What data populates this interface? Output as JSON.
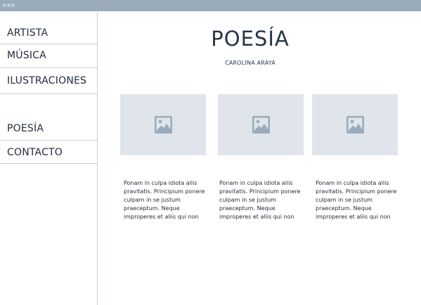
{
  "colors": {
    "titlebar": "#9aacbb",
    "placeholder": "#dfe5ea",
    "placeholder_icon": "#9aacbb",
    "divider": "#c6d0d8",
    "text": "#1f2b3a"
  },
  "nav": {
    "items": [
      {
        "label": "ARTISTA"
      },
      {
        "label": "MÚSICA"
      },
      {
        "label": "ILUSTRACIONES"
      },
      {
        "label": "POESÍA"
      },
      {
        "label": "CONTACTO"
      }
    ]
  },
  "main": {
    "title": "POESÍA",
    "subtitle": "CAROLINA ARAYA",
    "cards": [
      {
        "image_icon": "image-icon",
        "text": "Ponam in culpa idiota aliis pravitatis. Principium ponere culpam in se justum praeceptum. Neque improperes et aliis qui non"
      },
      {
        "image_icon": "image-icon",
        "text": "Ponam in culpa idiota aliis pravitatis. Principium ponere culpam in se justum praeceptum. Neque improperes et aliis qui non"
      },
      {
        "image_icon": "image-icon",
        "text": "Ponam in culpa idiota aliis pravitatis. Principium ponere culpam in se justum praeceptum. Neque improperes et aliis qui non"
      }
    ]
  }
}
